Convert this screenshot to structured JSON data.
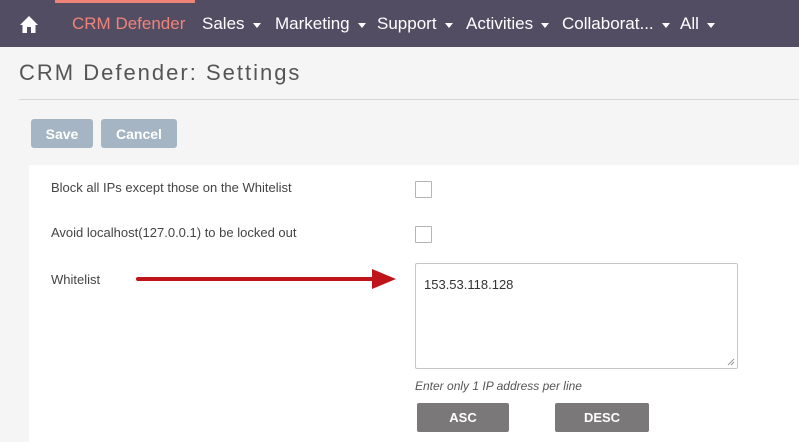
{
  "nav": {
    "items": [
      {
        "label": "CRM Defender",
        "active": true,
        "caret": false
      },
      {
        "label": "Sales",
        "caret": true
      },
      {
        "label": "Marketing",
        "caret": true
      },
      {
        "label": "Support",
        "caret": true
      },
      {
        "label": "Activities",
        "caret": true
      },
      {
        "label": "Collaborat...",
        "caret": true
      },
      {
        "label": "All",
        "caret": true
      }
    ],
    "background": "#534d64",
    "accent": "#f08377"
  },
  "page": {
    "title": "CRM Defender: Settings"
  },
  "toolbar": {
    "save_label": "Save",
    "cancel_label": "Cancel"
  },
  "settings": {
    "block_all_label": "Block all IPs except those on the Whitelist",
    "block_all_checked": false,
    "avoid_localhost_label": "Avoid localhost(127.0.0.1) to be locked out",
    "avoid_localhost_checked": false,
    "whitelist_label": "Whitelist",
    "whitelist_value": "153.53.118.128",
    "whitelist_hint": "Enter only 1 IP address per line",
    "asc_label": "ASC",
    "desc_label": "DESC"
  }
}
